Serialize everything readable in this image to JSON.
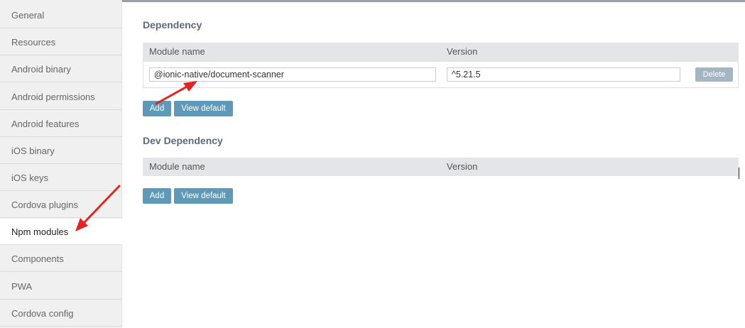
{
  "sidebar": {
    "items": [
      {
        "label": "General"
      },
      {
        "label": "Resources"
      },
      {
        "label": "Android binary"
      },
      {
        "label": "Android permissions"
      },
      {
        "label": "Android features"
      },
      {
        "label": "iOS binary"
      },
      {
        "label": "iOS keys"
      },
      {
        "label": "Cordova plugins"
      },
      {
        "label": "Npm modules",
        "active": true
      },
      {
        "label": "Components"
      },
      {
        "label": "PWA"
      },
      {
        "label": "Cordova config"
      }
    ]
  },
  "dependency": {
    "title": "Dependency",
    "columns": {
      "module": "Module name",
      "version": "Version"
    },
    "rows": [
      {
        "module": "@ionic-native/document-scanner",
        "version": "^5.21.5",
        "delete_label": "Delete"
      }
    ],
    "add_label": "Add",
    "view_default_label": "View default"
  },
  "dev_dependency": {
    "title": "Dev Dependency",
    "columns": {
      "module": "Module name",
      "version": "Version"
    },
    "add_label": "Add",
    "view_default_label": "View default"
  },
  "colors": {
    "accent_button": "#5e9ab8",
    "delete_button": "#a5b6c3",
    "annotation_arrow": "#e52421"
  },
  "annotations": {
    "arrows": [
      "arrow-to-module-input",
      "arrow-to-npm-modules"
    ]
  }
}
